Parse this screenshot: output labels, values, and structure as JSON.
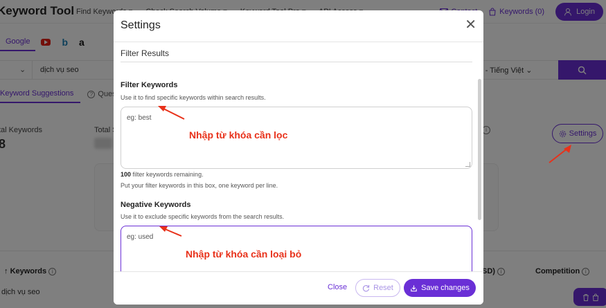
{
  "app": {
    "logo": "Keyword Tool",
    "nav": [
      "Find Keywords ▾",
      "Check Search Volume ▾",
      "Keyword Tool Pro ▾",
      "API Access ▾"
    ],
    "contact": "Contact",
    "keywords_count": "Keywords (0)",
    "login": "Login"
  },
  "engines": {
    "google": "Google",
    "youtube_icon": "youtube-icon",
    "bing_glyph": "b",
    "amazon_glyph": "a"
  },
  "search": {
    "value": "dịch vụ seo",
    "language": "ese - Tiếng Việt"
  },
  "result_tabs": {
    "suggestions": "Keyword Suggestions",
    "questions": "Ques"
  },
  "stats": {
    "label1": "tal Keywords",
    "value1": "8",
    "label2": "Total S"
  },
  "settings_button": "Settings",
  "table": {
    "col_keywords": "Keywords",
    "col_usd": "SD)",
    "col_competition": "Competition",
    "row1_keyword": "dịch vụ seo"
  },
  "modal": {
    "title": "Settings",
    "close_glyph": "✕",
    "section_title": "Filter Results",
    "filter": {
      "label": "Filter Keywords",
      "help": "Use it to find specific keywords within search results.",
      "placeholder": "eg: best",
      "remaining_count": "100",
      "remaining_text": " filter keywords remaining.",
      "put_help": "Put your filter keywords in this box, one keyword per line."
    },
    "negative": {
      "label": "Negative Keywords",
      "help": "Use it to exclude specific keywords from the search results.",
      "placeholder": "eg: used"
    },
    "footer": {
      "close": "Close",
      "reset": "Reset",
      "save": "Save changes"
    }
  },
  "annotations": {
    "filter": "Nhập từ khóa cần lọc",
    "negative": "Nhập từ khóa cần loại bỏ"
  },
  "colors": {
    "accent": "#6a2fd6",
    "annotation": "#e8311a"
  }
}
